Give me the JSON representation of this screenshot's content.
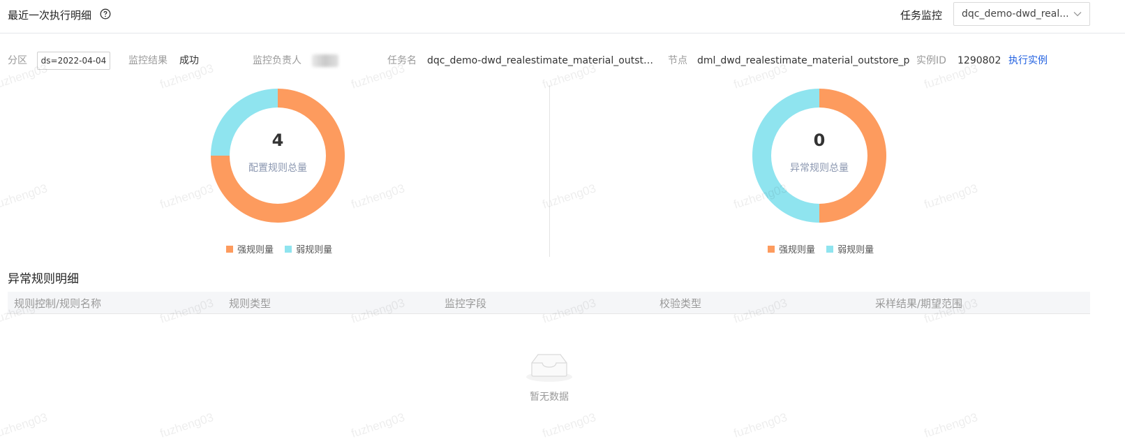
{
  "header": {
    "title": "最近一次执行明细",
    "task_monitor_label": "任务监控",
    "task_select_value": "dqc_demo-dwd_real..."
  },
  "info": {
    "partition_label": "分区",
    "partition_value": "ds=2022-04-04",
    "result_label": "监控结果",
    "result_value": "成功",
    "owner_label": "监控负责人",
    "task_name_label": "任务名",
    "task_name_value": "dqc_demo-dwd_realestimate_material_outsto...",
    "node_label": "节点",
    "node_value": "dml_dwd_realestimate_material_outstore_p",
    "instance_label": "实例ID",
    "instance_value": "1290802",
    "exec_link": "执行实例"
  },
  "colors": {
    "strong": "#fd9b5e",
    "weak": "#8fe4ef",
    "link": "#1f5fe0"
  },
  "chart_data": [
    {
      "type": "pie",
      "center_value": "4",
      "center_label": "配置规则总量",
      "categories": [
        "强规则量",
        "弱规则量"
      ],
      "values": [
        3,
        1
      ]
    },
    {
      "type": "pie",
      "center_value": "0",
      "center_label": "异常规则总量",
      "categories": [
        "强规则量",
        "弱规则量"
      ],
      "values": [
        1,
        1
      ]
    }
  ],
  "table": {
    "title": "异常规则明细",
    "columns": [
      "规则控制/规则名称",
      "规则类型",
      "监控字段",
      "校验类型",
      "采样结果/期望范围"
    ],
    "empty_text": "暂无数据"
  },
  "watermark": "fuzheng03"
}
